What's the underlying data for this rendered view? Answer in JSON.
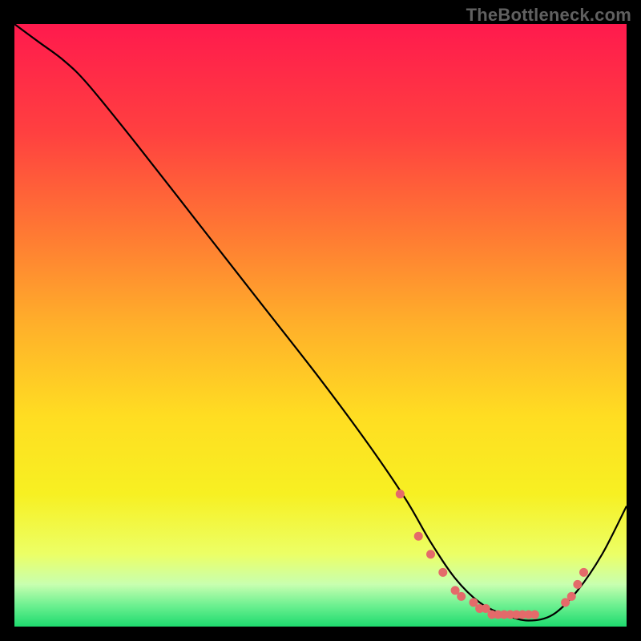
{
  "watermark": "TheBottleneck.com",
  "chart_data": {
    "type": "line",
    "title": "",
    "xlabel": "",
    "ylabel": "",
    "xlim": [
      0,
      100
    ],
    "ylim": [
      0,
      100
    ],
    "gradient_stops": [
      {
        "offset": 0.0,
        "color": "#ff1a4d"
      },
      {
        "offset": 0.18,
        "color": "#ff4040"
      },
      {
        "offset": 0.35,
        "color": "#ff7a33"
      },
      {
        "offset": 0.5,
        "color": "#ffb02a"
      },
      {
        "offset": 0.65,
        "color": "#ffdd22"
      },
      {
        "offset": 0.78,
        "color": "#f7f022"
      },
      {
        "offset": 0.88,
        "color": "#ecff66"
      },
      {
        "offset": 0.93,
        "color": "#c8ffb0"
      },
      {
        "offset": 0.965,
        "color": "#6cf090"
      },
      {
        "offset": 1.0,
        "color": "#1eda6e"
      }
    ],
    "series": [
      {
        "name": "bottleneck-curve",
        "type": "line",
        "color": "#000000",
        "x": [
          0,
          4,
          8,
          12,
          20,
          30,
          40,
          50,
          58,
          64,
          68,
          72,
          76,
          80,
          84,
          88,
          92,
          96,
          100
        ],
        "y": [
          100,
          97,
          94,
          90,
          80,
          67,
          54,
          41,
          30,
          21,
          14,
          8,
          4,
          2,
          1,
          2,
          6,
          12,
          20
        ]
      },
      {
        "name": "highlight-points",
        "type": "scatter",
        "color": "#e46a6a",
        "x": [
          63,
          66,
          68,
          70,
          72,
          73,
          75,
          76,
          77,
          78,
          79,
          80,
          81,
          82,
          83,
          84,
          85,
          90,
          91,
          92,
          93
        ],
        "y": [
          22,
          15,
          12,
          9,
          6,
          5,
          4,
          3,
          3,
          2,
          2,
          2,
          2,
          2,
          2,
          2,
          2,
          4,
          5,
          7,
          9
        ]
      }
    ]
  }
}
